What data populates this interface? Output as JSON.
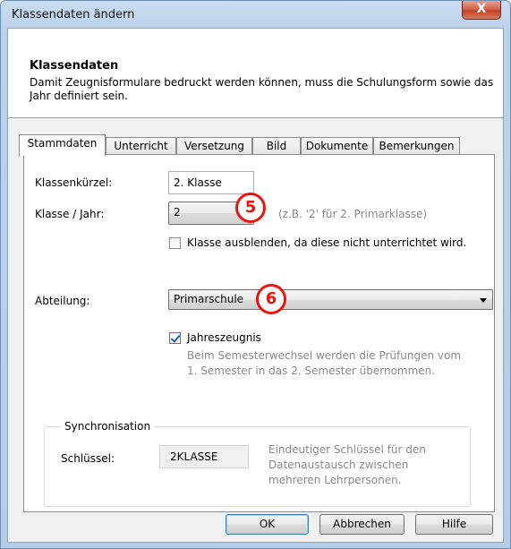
{
  "window": {
    "title": "Klassendaten ändern",
    "close_glyph": "X"
  },
  "header": {
    "title": "Klassendaten",
    "description": "Damit Zeugnisformulare bedruckt werden können, muss die Schulungsform sowie das Jahr definiert sein."
  },
  "tabs": [
    {
      "label": "Stammdaten",
      "active": true
    },
    {
      "label": "Unterricht",
      "active": false
    },
    {
      "label": "Versetzung",
      "active": false
    },
    {
      "label": "Bild",
      "active": false
    },
    {
      "label": "Dokumente",
      "active": false
    },
    {
      "label": "Bemerkungen",
      "active": false
    }
  ],
  "form": {
    "kuerzel_label": "Klassenkürzel:",
    "kuerzel_value": "2. Klasse",
    "klasse_label": "Klasse / Jahr:",
    "klasse_value": "2",
    "klasse_hint": "(z.B. '2' für 2. Primarklasse)",
    "ausblenden_label": "Klasse ausblenden, da diese nicht unterrichtet wird.",
    "ausblenden_checked": false,
    "abteilung_label": "Abteilung:",
    "abteilung_value": "Primarschule",
    "jahreszeugnis_label": "Jahreszeugnis",
    "jahreszeugnis_checked": true,
    "jahreszeugnis_hint_line1": "Beim Semesterwechsel werden die Prüfungen vom",
    "jahreszeugnis_hint_line2": "1. Semester in das 2. Semester übernommen."
  },
  "sync": {
    "legend": "Synchronisation",
    "key_label": "Schlüssel:",
    "key_value": "2KLASSE",
    "hint_line1": "Eindeutiger Schlüssel für den",
    "hint_line2": "Datenaustausch zwischen",
    "hint_line3": "mehreren Lehrpersonen."
  },
  "markers": {
    "m5": "5",
    "m6": "6"
  },
  "buttons": {
    "ok": "OK",
    "cancel": "Abbrechen",
    "help": "Hilfe"
  },
  "colors": {
    "marker": "#e8160c",
    "close_button": "#c14528"
  }
}
